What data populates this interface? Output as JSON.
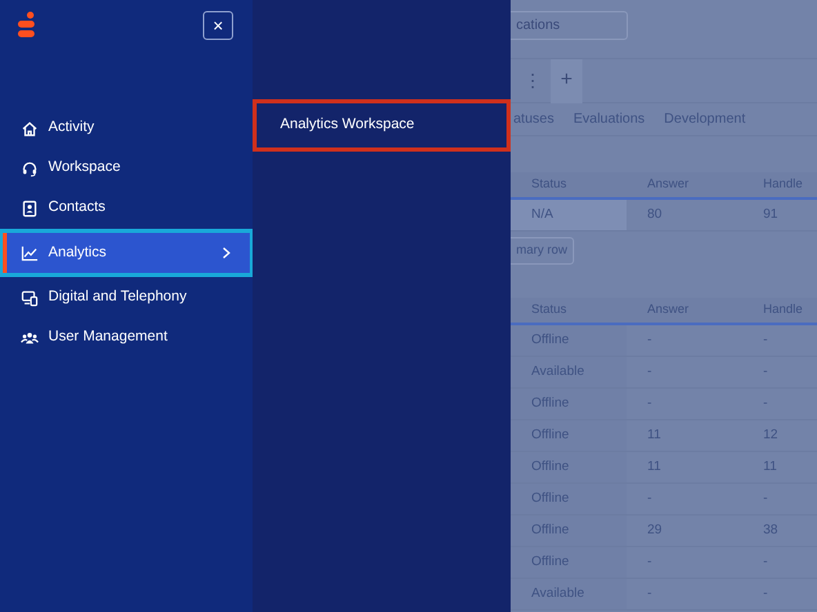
{
  "sidebar": {
    "close_button": "×",
    "items": [
      {
        "label": "Activity",
        "kind": "home",
        "selected": false,
        "has_submenu": false
      },
      {
        "label": "Workspace",
        "kind": "headset",
        "selected": false,
        "has_submenu": false
      },
      {
        "label": "Contacts",
        "kind": "contact",
        "selected": false,
        "has_submenu": false
      },
      {
        "label": "Analytics",
        "kind": "chart",
        "selected": true,
        "has_submenu": true
      },
      {
        "label": "Digital and Telephony",
        "kind": "devices",
        "selected": false,
        "has_submenu": false
      },
      {
        "label": "User Management",
        "kind": "users",
        "selected": false,
        "has_submenu": false
      }
    ]
  },
  "submenu": {
    "items": [
      {
        "label": "Analytics Workspace",
        "selected": true
      }
    ]
  },
  "background": {
    "search": {
      "value": "cations"
    },
    "more_button": "⋮",
    "add_tab_button": "+",
    "tabs": [
      "atuses",
      "Evaluations",
      "Development"
    ],
    "summary_table": {
      "columns": [
        "Status",
        "Answer",
        "Handle"
      ],
      "rows": [
        [
          "N/A",
          "80",
          "91"
        ]
      ]
    },
    "summary_button": "mary row",
    "agents_table": {
      "columns": [
        "Status",
        "Answer",
        "Handle"
      ],
      "rows": [
        [
          "Offline",
          "-",
          "-"
        ],
        [
          "Available",
          "-",
          "-"
        ],
        [
          "Offline",
          "-",
          "-"
        ],
        [
          "Offline",
          "11",
          "12"
        ],
        [
          "Offline",
          "11",
          "11"
        ],
        [
          "Offline",
          "-",
          "-"
        ],
        [
          "Offline",
          "29",
          "38"
        ],
        [
          "Offline",
          "-",
          "-"
        ],
        [
          "Available",
          "-",
          "-"
        ]
      ]
    }
  }
}
